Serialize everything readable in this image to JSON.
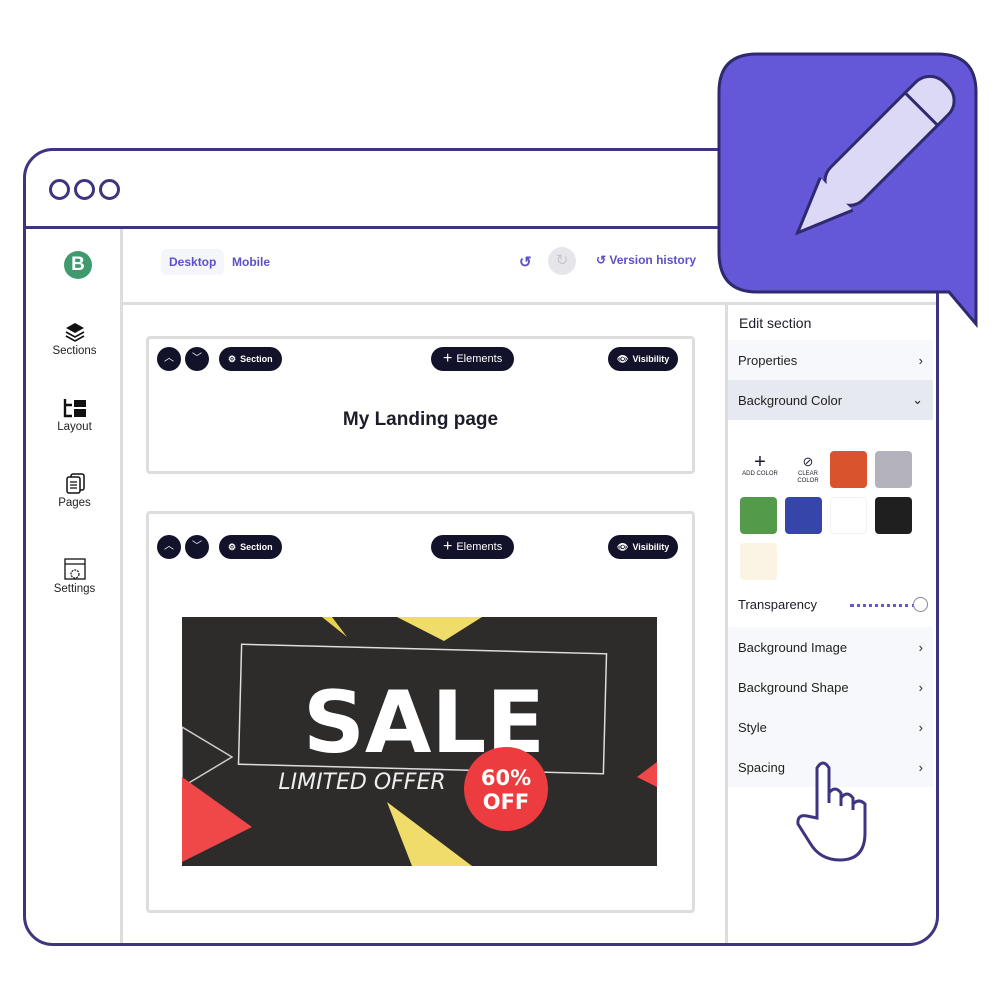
{
  "window": {
    "dots": 3
  },
  "sidebar": {
    "logo": "B",
    "items": [
      {
        "label": "Sections",
        "icon": "layers-icon"
      },
      {
        "label": "Layout",
        "icon": "layout-icon"
      },
      {
        "label": "Pages",
        "icon": "pages-icon"
      },
      {
        "label": "Settings",
        "icon": "settings-icon"
      }
    ]
  },
  "header": {
    "tabs": [
      {
        "label": "Desktop",
        "active": true
      },
      {
        "label": "Mobile",
        "active": false
      }
    ],
    "version_history": "Version history"
  },
  "sections": [
    {
      "section_label": "Section",
      "elements_label": "Elements",
      "visibility_label": "Visibility",
      "heading": "My Landing page"
    },
    {
      "section_label": "Section",
      "elements_label": "Elements",
      "visibility_label": "Visibility",
      "banner": {
        "title": "SALE",
        "subtitle": "LIMITED OFFER",
        "discount_line1": "60%",
        "discount_line2": "OFF"
      }
    }
  ],
  "panel": {
    "title": "Edit section",
    "rows": {
      "properties": "Properties",
      "background_color": "Background Color",
      "background_image": "Background Image",
      "background_shape": "Background Shape",
      "style": "Style",
      "spacing": "Spacing"
    },
    "add_color": "ADD COLOR",
    "clear_color_1": "CLEAR",
    "clear_color_2": "COLOR",
    "swatches": [
      "#d9542c",
      "#b4b3bd",
      "#539b4b",
      "#3545aa",
      "#ffffff",
      "#1f1f1f",
      "#fbf3e3"
    ],
    "transparency_label": "Transparency",
    "transparency": 1.0
  },
  "colors": {
    "brand": "#5b50c9",
    "frame": "#3d3580",
    "badge": "#6457d8"
  }
}
